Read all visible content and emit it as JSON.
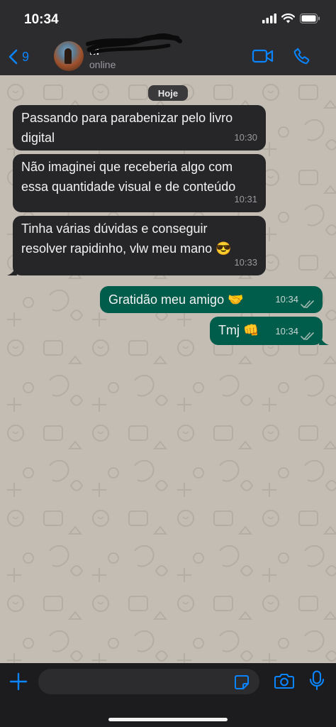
{
  "status_bar": {
    "time": "10:34"
  },
  "header": {
    "back_count": "9",
    "contact_name": "M",
    "contact_status": "online"
  },
  "chat": {
    "date_label": "Hoje",
    "messages": [
      {
        "direction": "in",
        "line1": "Passando para parabenizar pelo livro",
        "line2": "digital",
        "time": "10:30"
      },
      {
        "direction": "in",
        "line1": "Não imaginei que receberia algo com",
        "line2": "essa quantidade visual e de conteúdo",
        "time": "10:31"
      },
      {
        "direction": "in",
        "line1": "Tinha várias dúvidas e conseguir",
        "line2": "resolver rapidinho, vlw meu mano 😎",
        "time": "10:33"
      },
      {
        "direction": "out",
        "text": "Gratidão meu amigo 🤝",
        "time": "10:34",
        "status": "read"
      },
      {
        "direction": "out",
        "text": "Tmj 👊",
        "time": "10:34",
        "status": "read"
      }
    ]
  },
  "footer": {
    "input_value": "",
    "input_placeholder": ""
  },
  "colors": {
    "accent": "#0a84ff",
    "incoming_bubble": "#262628",
    "outgoing_bubble": "#005c4b",
    "chat_background": "#c4bdb3"
  }
}
